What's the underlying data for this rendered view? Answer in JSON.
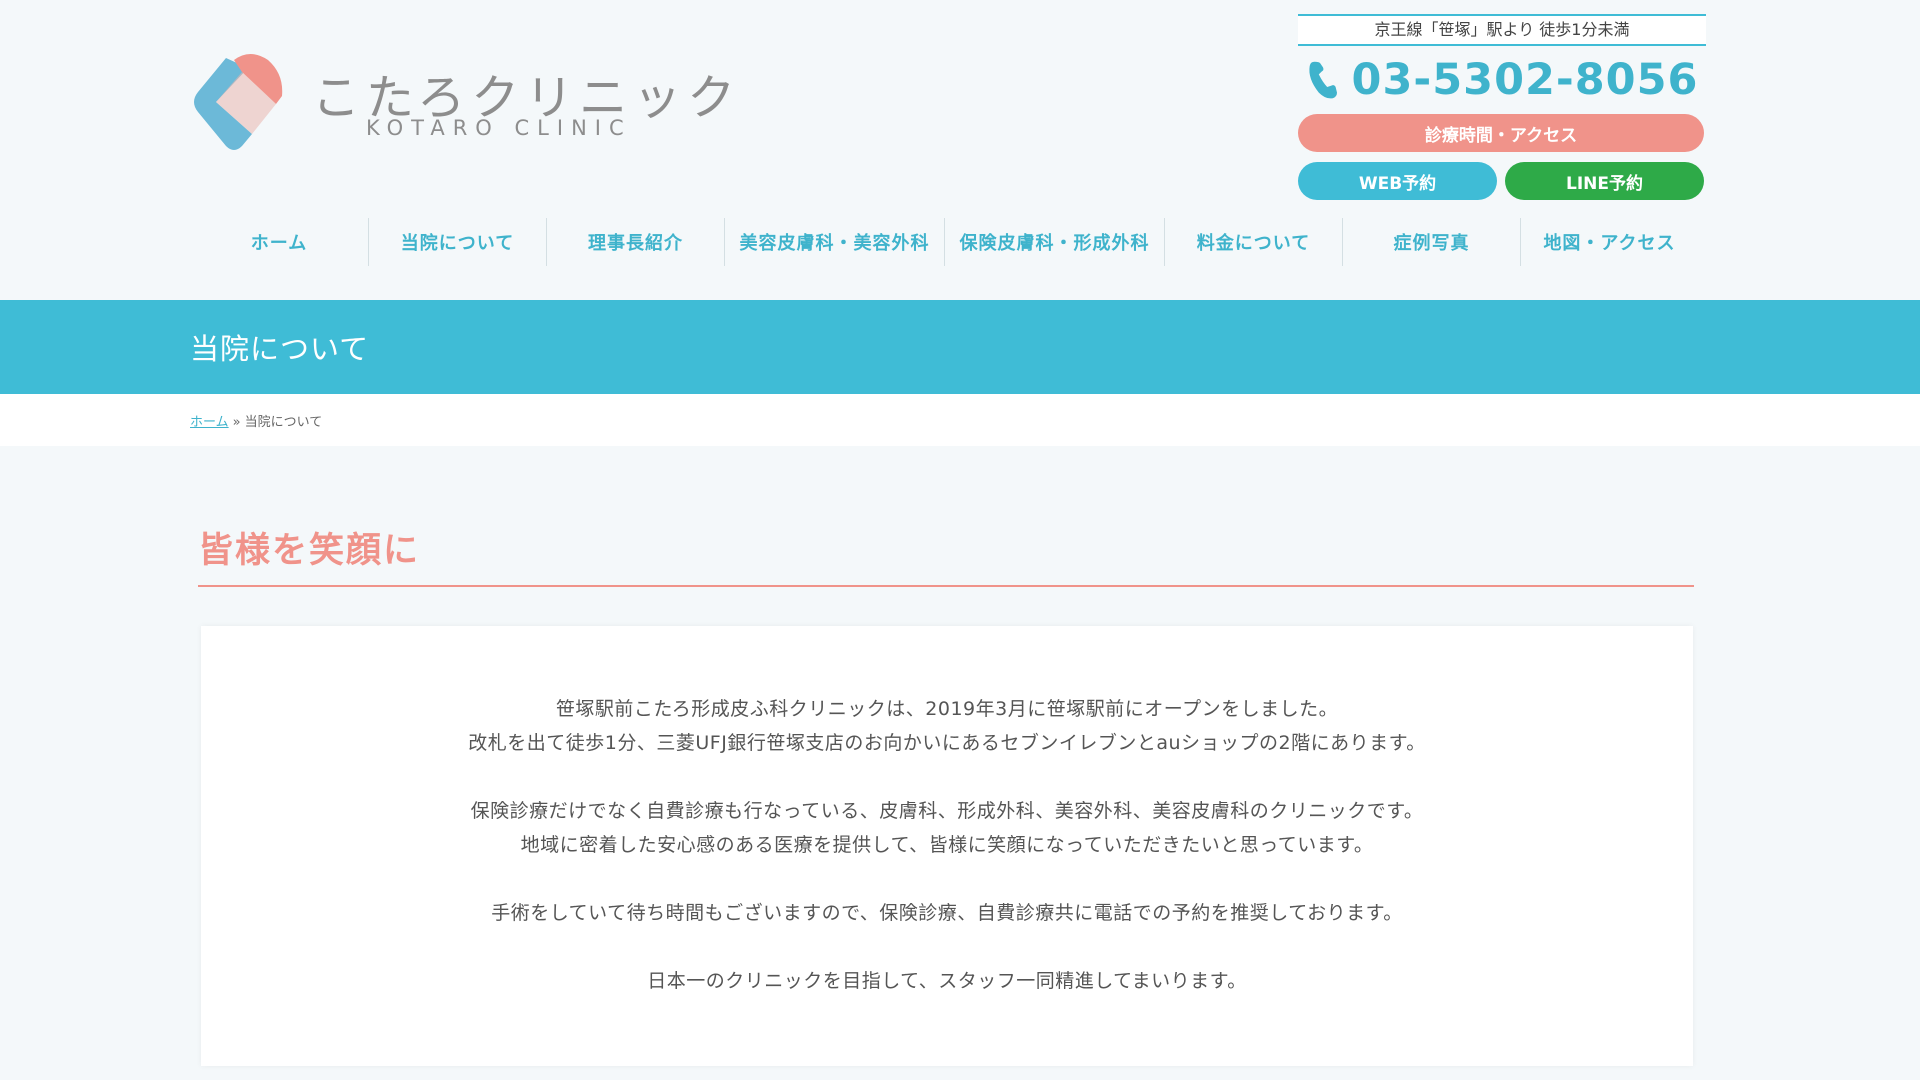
{
  "brand": {
    "name_jp": "こたろクリニック",
    "name_en": "KOTARO CLINIC",
    "colors": {
      "accent_blue": "#3fbcd6",
      "accent_pink": "#f0938a",
      "line_green": "#2eaa48"
    }
  },
  "contact": {
    "access": "京王線「笹塚」駅より 徒歩1分未満",
    "phone": "03-5302-8056",
    "phone_icon": "phone-icon",
    "hours_button": "診療時間・アクセス",
    "web_button": "WEB予約",
    "line_button": "LINE予約"
  },
  "nav": {
    "items": [
      {
        "label": "ホーム"
      },
      {
        "label": "当院について"
      },
      {
        "label": "理事長紹介"
      },
      {
        "label": "美容皮膚科・美容外科"
      },
      {
        "label": "保険皮膚科・形成外科"
      },
      {
        "label": "料金について"
      },
      {
        "label": "症例写真"
      },
      {
        "label": "地図・アクセス"
      }
    ]
  },
  "page": {
    "title": "当院について"
  },
  "breadcrumb": {
    "home": "ホーム",
    "separator": "»",
    "current": "当院について"
  },
  "section": {
    "heading": "皆様を笑顔に",
    "paragraphs": [
      {
        "lines": [
          "笹塚駅前こたろ形成皮ふ科クリニックは、2019年3月に笹塚駅前にオープンをしました。",
          "改札を出て徒歩1分、三菱UFJ銀行笹塚支店のお向かいにあるセブンイレブンとauショップの2階にあります。"
        ]
      },
      {
        "lines": [
          "保険診療だけでなく自費診療も行なっている、皮膚科、形成外科、美容外科、美容皮膚科のクリニックです。",
          "地域に密着した安心感のある医療を提供して、皆様に笑顔になっていただきたいと思っています。"
        ]
      },
      {
        "lines": [
          "手術をしていて待ち時間もございますので、保険診療、自費診療共に電話での予約を推奨しております。"
        ]
      },
      {
        "lines": [
          "日本一のクリニックを目指して、スタッフ一同精進してまいります。"
        ]
      }
    ]
  }
}
